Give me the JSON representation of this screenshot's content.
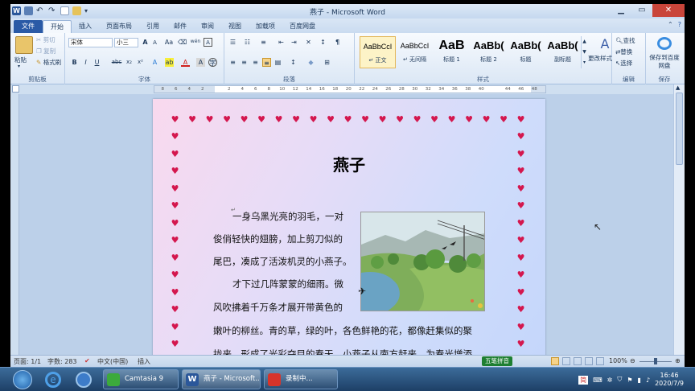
{
  "window": {
    "title": "燕子 - Microsoft Word"
  },
  "tabs": [
    {
      "label": "文件"
    },
    {
      "label": "开始"
    },
    {
      "label": "插入"
    },
    {
      "label": "页面布局"
    },
    {
      "label": "引用"
    },
    {
      "label": "邮件"
    },
    {
      "label": "审阅"
    },
    {
      "label": "视图"
    },
    {
      "label": "加载项"
    },
    {
      "label": "百度网盘"
    }
  ],
  "ribbon": {
    "clipboard": {
      "paste": "粘贴",
      "cut": "剪切",
      "copy": "复制",
      "format_painter": "格式刷",
      "group": "剪贴板"
    },
    "font": {
      "name": "宋体",
      "size": "小三",
      "group": "字体",
      "bold": "B",
      "italic": "I",
      "underline": "U",
      "strike": "abc",
      "sub": "x₂",
      "sup": "x²",
      "grow": "A",
      "shrink": "A",
      "case": "Aa",
      "wen": "wén",
      "border_char": "A"
    },
    "paragraph": {
      "group": "段落"
    },
    "styles": {
      "group": "样式",
      "items": [
        {
          "sample": "AaBbCcI",
          "name": "↵ 正文"
        },
        {
          "sample": "AaBbCcI",
          "name": "↵ 无间隔"
        },
        {
          "sample": "AaB",
          "name": "标题 1"
        },
        {
          "sample": "AaBb(",
          "name": "标题 2"
        },
        {
          "sample": "AaBb(",
          "name": "标题"
        },
        {
          "sample": "AaBb(",
          "name": "副标题"
        }
      ],
      "change": "更改样式"
    },
    "editing": {
      "find": "查找",
      "replace": "替换",
      "select": "选择",
      "group": "编辑"
    },
    "save": {
      "label": "保存到百度网盘",
      "group": "保存"
    }
  },
  "ruler": {
    "ticks": [
      "8",
      "6",
      "4",
      "2",
      "",
      "2",
      "4",
      "6",
      "8",
      "10",
      "12",
      "14",
      "16",
      "18",
      "20",
      "22",
      "24",
      "26",
      "28",
      "30",
      "32",
      "34",
      "36",
      "38",
      "40",
      "",
      "44",
      "46",
      "48"
    ]
  },
  "document": {
    "title": "燕子",
    "lines": [
      "一身乌黑光亮的羽毛，一对",
      "俊俏轻快的翅膀，加上剪刀似的",
      "尾巴，凑成了活泼机灵的小燕子。",
      "才下过几阵蒙蒙的细雨。微",
      "风吹拂着千万条才展开带黄色的",
      "嫩叶的柳丝。青的草，绿的叶，各色鲜艳的花，都像赶集似的聚",
      "拢来，形成了光彩夺目的春天。小燕子从南方赶来，为春光增添"
    ]
  },
  "status": {
    "page": "页面: 1/1",
    "words": "字数: 283",
    "lang": "中文(中国)",
    "mode": "插入",
    "ime": "五笔拼音",
    "zoom": "100%"
  },
  "taskbar": {
    "apps": [
      {
        "label": "Camtasia 9"
      },
      {
        "label": "燕子 - Microsoft..."
      },
      {
        "label": "录制中..."
      }
    ],
    "tray_ime": "简",
    "time": "16:46",
    "date": "2020/7/9"
  },
  "colors": {
    "accent": "#2a5aa6",
    "heart": "#d4174e",
    "ime": "#1e7f32"
  }
}
